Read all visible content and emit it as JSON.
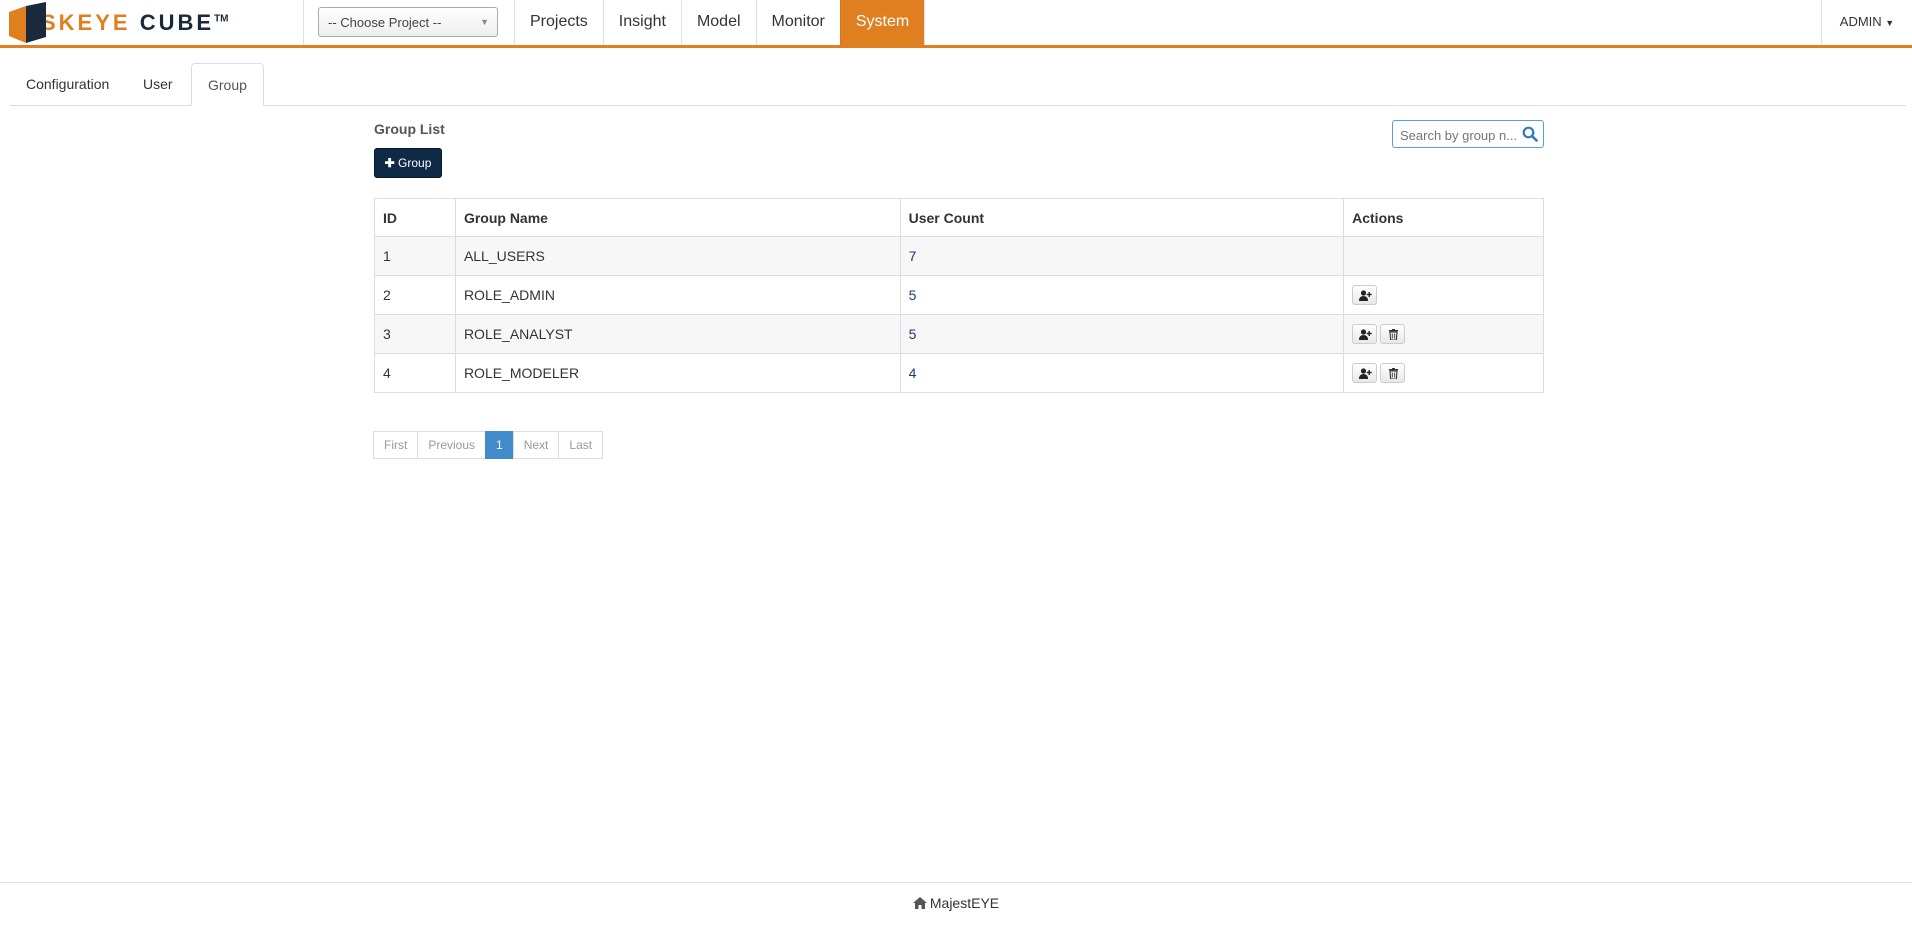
{
  "brand": {
    "name": "SKEYE",
    "name2": "CUBE",
    "tm": "TM"
  },
  "project_select": {
    "value": "-- Choose Project --"
  },
  "nav": {
    "items": [
      "Projects",
      "Insight",
      "Model",
      "Monitor",
      "System"
    ],
    "active": "System"
  },
  "user_menu": {
    "label": "ADMIN"
  },
  "tabs": {
    "items": [
      "Configuration",
      "User",
      "Group"
    ],
    "active": "Group"
  },
  "group_list": {
    "title": "Group List",
    "add_button": "Group",
    "search_placeholder": "Search by group n..."
  },
  "table": {
    "headers": [
      "ID",
      "Group Name",
      "User Count",
      "Actions"
    ],
    "rows": [
      {
        "id": "1",
        "name": "ALL_USERS",
        "count": "7",
        "actions": []
      },
      {
        "id": "2",
        "name": "ROLE_ADMIN",
        "count": "5",
        "actions": [
          "add-user"
        ]
      },
      {
        "id": "3",
        "name": "ROLE_ANALYST",
        "count": "5",
        "actions": [
          "add-user",
          "delete"
        ]
      },
      {
        "id": "4",
        "name": "ROLE_MODELER",
        "count": "4",
        "actions": [
          "add-user",
          "delete"
        ]
      }
    ]
  },
  "pagination": {
    "first": "First",
    "previous": "Previous",
    "current": "1",
    "next": "Next",
    "last": "Last"
  },
  "footer": {
    "text": "MajestEYE"
  },
  "colors": {
    "accent": "#e07f1f",
    "button_dark": "#0e2a47",
    "pager_active": "#428bca"
  }
}
